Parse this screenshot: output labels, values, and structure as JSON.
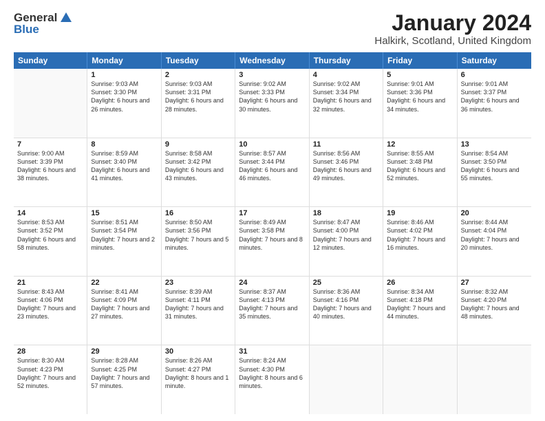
{
  "header": {
    "logo_general": "General",
    "logo_blue": "Blue",
    "month_title": "January 2024",
    "location": "Halkirk, Scotland, United Kingdom"
  },
  "days_of_week": [
    "Sunday",
    "Monday",
    "Tuesday",
    "Wednesday",
    "Thursday",
    "Friday",
    "Saturday"
  ],
  "weeks": [
    [
      {
        "day": "",
        "sunrise": "",
        "sunset": "",
        "daylight": "",
        "empty": true
      },
      {
        "day": "1",
        "sunrise": "Sunrise: 9:03 AM",
        "sunset": "Sunset: 3:30 PM",
        "daylight": "Daylight: 6 hours and 26 minutes.",
        "empty": false
      },
      {
        "day": "2",
        "sunrise": "Sunrise: 9:03 AM",
        "sunset": "Sunset: 3:31 PM",
        "daylight": "Daylight: 6 hours and 28 minutes.",
        "empty": false
      },
      {
        "day": "3",
        "sunrise": "Sunrise: 9:02 AM",
        "sunset": "Sunset: 3:33 PM",
        "daylight": "Daylight: 6 hours and 30 minutes.",
        "empty": false
      },
      {
        "day": "4",
        "sunrise": "Sunrise: 9:02 AM",
        "sunset": "Sunset: 3:34 PM",
        "daylight": "Daylight: 6 hours and 32 minutes.",
        "empty": false
      },
      {
        "day": "5",
        "sunrise": "Sunrise: 9:01 AM",
        "sunset": "Sunset: 3:36 PM",
        "daylight": "Daylight: 6 hours and 34 minutes.",
        "empty": false
      },
      {
        "day": "6",
        "sunrise": "Sunrise: 9:01 AM",
        "sunset": "Sunset: 3:37 PM",
        "daylight": "Daylight: 6 hours and 36 minutes.",
        "empty": false
      }
    ],
    [
      {
        "day": "7",
        "sunrise": "Sunrise: 9:00 AM",
        "sunset": "Sunset: 3:39 PM",
        "daylight": "Daylight: 6 hours and 38 minutes.",
        "empty": false
      },
      {
        "day": "8",
        "sunrise": "Sunrise: 8:59 AM",
        "sunset": "Sunset: 3:40 PM",
        "daylight": "Daylight: 6 hours and 41 minutes.",
        "empty": false
      },
      {
        "day": "9",
        "sunrise": "Sunrise: 8:58 AM",
        "sunset": "Sunset: 3:42 PM",
        "daylight": "Daylight: 6 hours and 43 minutes.",
        "empty": false
      },
      {
        "day": "10",
        "sunrise": "Sunrise: 8:57 AM",
        "sunset": "Sunset: 3:44 PM",
        "daylight": "Daylight: 6 hours and 46 minutes.",
        "empty": false
      },
      {
        "day": "11",
        "sunrise": "Sunrise: 8:56 AM",
        "sunset": "Sunset: 3:46 PM",
        "daylight": "Daylight: 6 hours and 49 minutes.",
        "empty": false
      },
      {
        "day": "12",
        "sunrise": "Sunrise: 8:55 AM",
        "sunset": "Sunset: 3:48 PM",
        "daylight": "Daylight: 6 hours and 52 minutes.",
        "empty": false
      },
      {
        "day": "13",
        "sunrise": "Sunrise: 8:54 AM",
        "sunset": "Sunset: 3:50 PM",
        "daylight": "Daylight: 6 hours and 55 minutes.",
        "empty": false
      }
    ],
    [
      {
        "day": "14",
        "sunrise": "Sunrise: 8:53 AM",
        "sunset": "Sunset: 3:52 PM",
        "daylight": "Daylight: 6 hours and 58 minutes.",
        "empty": false
      },
      {
        "day": "15",
        "sunrise": "Sunrise: 8:51 AM",
        "sunset": "Sunset: 3:54 PM",
        "daylight": "Daylight: 7 hours and 2 minutes.",
        "empty": false
      },
      {
        "day": "16",
        "sunrise": "Sunrise: 8:50 AM",
        "sunset": "Sunset: 3:56 PM",
        "daylight": "Daylight: 7 hours and 5 minutes.",
        "empty": false
      },
      {
        "day": "17",
        "sunrise": "Sunrise: 8:49 AM",
        "sunset": "Sunset: 3:58 PM",
        "daylight": "Daylight: 7 hours and 8 minutes.",
        "empty": false
      },
      {
        "day": "18",
        "sunrise": "Sunrise: 8:47 AM",
        "sunset": "Sunset: 4:00 PM",
        "daylight": "Daylight: 7 hours and 12 minutes.",
        "empty": false
      },
      {
        "day": "19",
        "sunrise": "Sunrise: 8:46 AM",
        "sunset": "Sunset: 4:02 PM",
        "daylight": "Daylight: 7 hours and 16 minutes.",
        "empty": false
      },
      {
        "day": "20",
        "sunrise": "Sunrise: 8:44 AM",
        "sunset": "Sunset: 4:04 PM",
        "daylight": "Daylight: 7 hours and 20 minutes.",
        "empty": false
      }
    ],
    [
      {
        "day": "21",
        "sunrise": "Sunrise: 8:43 AM",
        "sunset": "Sunset: 4:06 PM",
        "daylight": "Daylight: 7 hours and 23 minutes.",
        "empty": false
      },
      {
        "day": "22",
        "sunrise": "Sunrise: 8:41 AM",
        "sunset": "Sunset: 4:09 PM",
        "daylight": "Daylight: 7 hours and 27 minutes.",
        "empty": false
      },
      {
        "day": "23",
        "sunrise": "Sunrise: 8:39 AM",
        "sunset": "Sunset: 4:11 PM",
        "daylight": "Daylight: 7 hours and 31 minutes.",
        "empty": false
      },
      {
        "day": "24",
        "sunrise": "Sunrise: 8:37 AM",
        "sunset": "Sunset: 4:13 PM",
        "daylight": "Daylight: 7 hours and 35 minutes.",
        "empty": false
      },
      {
        "day": "25",
        "sunrise": "Sunrise: 8:36 AM",
        "sunset": "Sunset: 4:16 PM",
        "daylight": "Daylight: 7 hours and 40 minutes.",
        "empty": false
      },
      {
        "day": "26",
        "sunrise": "Sunrise: 8:34 AM",
        "sunset": "Sunset: 4:18 PM",
        "daylight": "Daylight: 7 hours and 44 minutes.",
        "empty": false
      },
      {
        "day": "27",
        "sunrise": "Sunrise: 8:32 AM",
        "sunset": "Sunset: 4:20 PM",
        "daylight": "Daylight: 7 hours and 48 minutes.",
        "empty": false
      }
    ],
    [
      {
        "day": "28",
        "sunrise": "Sunrise: 8:30 AM",
        "sunset": "Sunset: 4:23 PM",
        "daylight": "Daylight: 7 hours and 52 minutes.",
        "empty": false
      },
      {
        "day": "29",
        "sunrise": "Sunrise: 8:28 AM",
        "sunset": "Sunset: 4:25 PM",
        "daylight": "Daylight: 7 hours and 57 minutes.",
        "empty": false
      },
      {
        "day": "30",
        "sunrise": "Sunrise: 8:26 AM",
        "sunset": "Sunset: 4:27 PM",
        "daylight": "Daylight: 8 hours and 1 minute.",
        "empty": false
      },
      {
        "day": "31",
        "sunrise": "Sunrise: 8:24 AM",
        "sunset": "Sunset: 4:30 PM",
        "daylight": "Daylight: 8 hours and 6 minutes.",
        "empty": false
      },
      {
        "day": "",
        "sunrise": "",
        "sunset": "",
        "daylight": "",
        "empty": true
      },
      {
        "day": "",
        "sunrise": "",
        "sunset": "",
        "daylight": "",
        "empty": true
      },
      {
        "day": "",
        "sunrise": "",
        "sunset": "",
        "daylight": "",
        "empty": true
      }
    ]
  ]
}
